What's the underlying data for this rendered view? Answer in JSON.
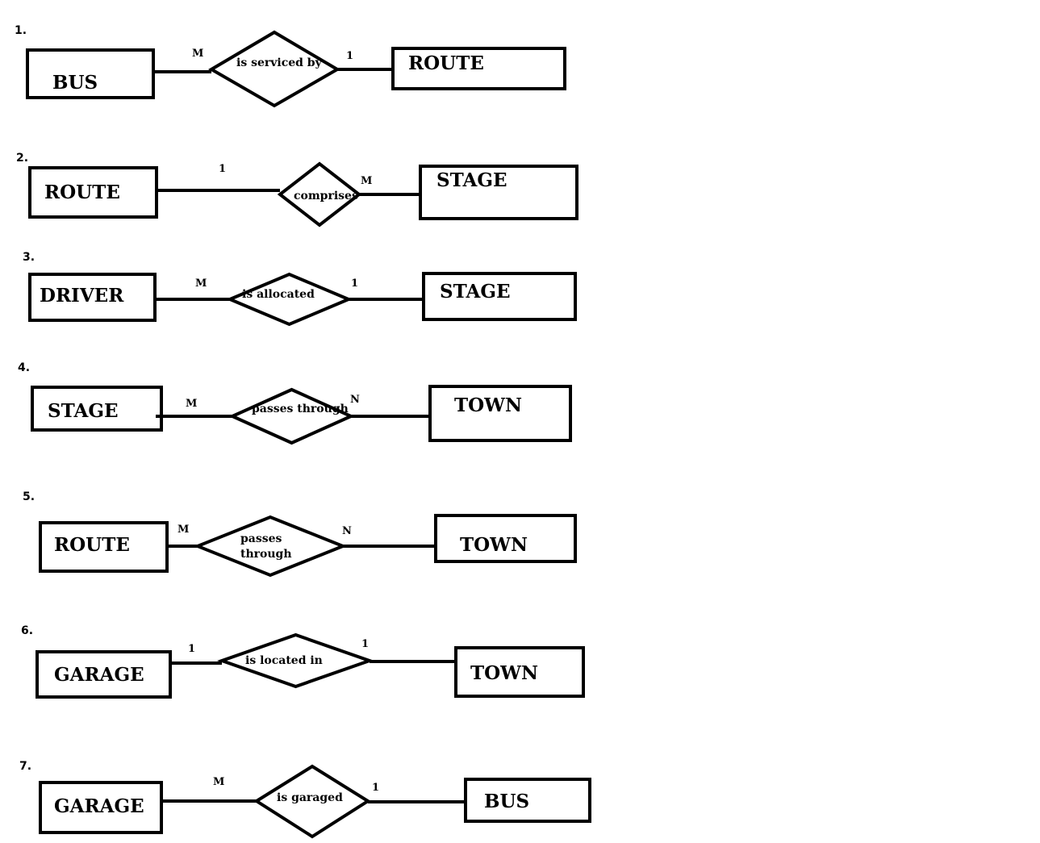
{
  "diagrams": [
    {
      "number": "1.",
      "left_entity": "BUS",
      "relationship": [
        "is serviced by"
      ],
      "right_entity": "ROUTE",
      "left_cardinality": "M",
      "right_cardinality": "1"
    },
    {
      "number": "2.",
      "left_entity": "ROUTE",
      "relationship": [
        "comprises"
      ],
      "right_entity": "STAGE",
      "left_cardinality": "1",
      "right_cardinality": "M"
    },
    {
      "number": "3.",
      "left_entity": "DRIVER",
      "relationship": [
        "is allocated"
      ],
      "right_entity": "STAGE",
      "left_cardinality": "M",
      "right_cardinality": "1"
    },
    {
      "number": "4.",
      "left_entity": "STAGE",
      "relationship": [
        "passes through"
      ],
      "right_entity": "TOWN",
      "left_cardinality": "M",
      "right_cardinality": "N"
    },
    {
      "number": "5.",
      "left_entity": "ROUTE",
      "relationship": [
        "passes",
        "through"
      ],
      "right_entity": "TOWN",
      "left_cardinality": "M",
      "right_cardinality": "N"
    },
    {
      "number": "6.",
      "left_entity": "GARAGE",
      "relationship": [
        "is located in"
      ],
      "right_entity": "TOWN",
      "left_cardinality": "1",
      "right_cardinality": "1"
    },
    {
      "number": "7.",
      "left_entity": "GARAGE",
      "relationship": [
        "is garaged"
      ],
      "right_entity": "BUS",
      "left_cardinality": "M",
      "right_cardinality": "1"
    }
  ]
}
